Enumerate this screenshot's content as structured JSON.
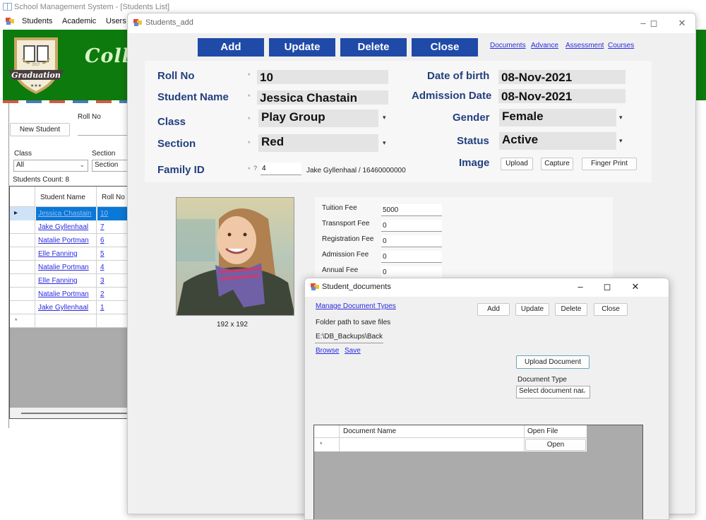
{
  "main_window": {
    "title": "School Management System - [Students List]",
    "menu": [
      "Students",
      "Academic",
      "Users"
    ],
    "banner": {
      "logo_text": "Graduation",
      "logo_year": "2017",
      "title_partial": "Coll"
    },
    "left_panel": {
      "new_student_label": "New Student",
      "roll_no_label": "Roll No",
      "roll_no_value": "",
      "class_label": "Class",
      "class_value": "All",
      "section_label": "Section",
      "section_value": "Section",
      "students_count_label": "Students Count: 8"
    },
    "students_grid": {
      "columns": [
        "Student Name",
        "Roll No"
      ],
      "rows": [
        {
          "name": "Jessica Chastain",
          "roll_no": "10",
          "selected": true
        },
        {
          "name": "Jake Gyllenhaal",
          "roll_no": "7"
        },
        {
          "name": "Natalie Portman",
          "roll_no": "6"
        },
        {
          "name": "Elle Fanning",
          "roll_no": "5"
        },
        {
          "name": "Natalie Portman",
          "roll_no": "4"
        },
        {
          "name": "Elle Fanning",
          "roll_no": "3"
        },
        {
          "name": "Natalie Portman",
          "roll_no": "2"
        },
        {
          "name": "Jake Gyllenhaal",
          "roll_no": "1"
        }
      ],
      "new_row_marker": "*"
    }
  },
  "students_add": {
    "title": "Students_add",
    "toolbar": {
      "add": "Add",
      "update": "Update",
      "delete": "Delete",
      "close": "Close"
    },
    "links": [
      "Documents",
      "Advance",
      "Assessment",
      "Courses"
    ],
    "form": {
      "roll_no_label": "Roll No",
      "roll_no": "10",
      "student_name_label": "Student Name",
      "student_name": "Jessica Chastain",
      "class_label": "Class",
      "class": "Play Group",
      "section_label": "Section",
      "section": "Red",
      "family_id_label": "Family ID",
      "family_id_marker": "?",
      "family_id": "4",
      "family_info": "Jake Gyllenhaal /  16460000000",
      "dob_label": "Date of birth",
      "dob": "08-Nov-2021",
      "admission_date_label": "Admission Date",
      "admission_date": "08-Nov-2021",
      "gender_label": "Gender",
      "gender": "Female",
      "status_label": "Status",
      "status": "Active",
      "image_label": "Image",
      "upload": "Upload",
      "capture": "Capture",
      "finger_print": "Finger Print",
      "required_marker": "*"
    },
    "photo_size": "192 x 192",
    "fees": [
      {
        "label": "Tuition Fee",
        "value": "5000"
      },
      {
        "label": "Trasnsport Fee",
        "value": "0"
      },
      {
        "label": "Registration Fee",
        "value": "0"
      },
      {
        "label": "Admission Fee",
        "value": "0"
      },
      {
        "label": "Annual Fee",
        "value": "0"
      }
    ]
  },
  "student_documents": {
    "title": "Student_documents",
    "manage_link": "Manage Document Types",
    "folder_label": "Folder path to save files",
    "folder_path": "E:\\DB_Backups\\Back",
    "browse": "Browse",
    "save": "Save",
    "toolbar": {
      "add": "Add",
      "update": "Update",
      "delete": "Delete",
      "close": "Close"
    },
    "upload_document": "Upload Document",
    "doc_type_label": "Document Type",
    "doc_type_value": "Select document nar",
    "grid": {
      "columns": [
        "Document Name",
        "Open File"
      ],
      "new_row_marker": "*",
      "open_button": "Open"
    }
  },
  "colors": {
    "banner_green": "#0d7a0d",
    "toolbar_blue": "#1f4aa8",
    "label_navy": "#23407f",
    "link_blue": "#2a2ae0",
    "selection_blue": "#0a78d7",
    "grid_gray": "#ababab"
  }
}
